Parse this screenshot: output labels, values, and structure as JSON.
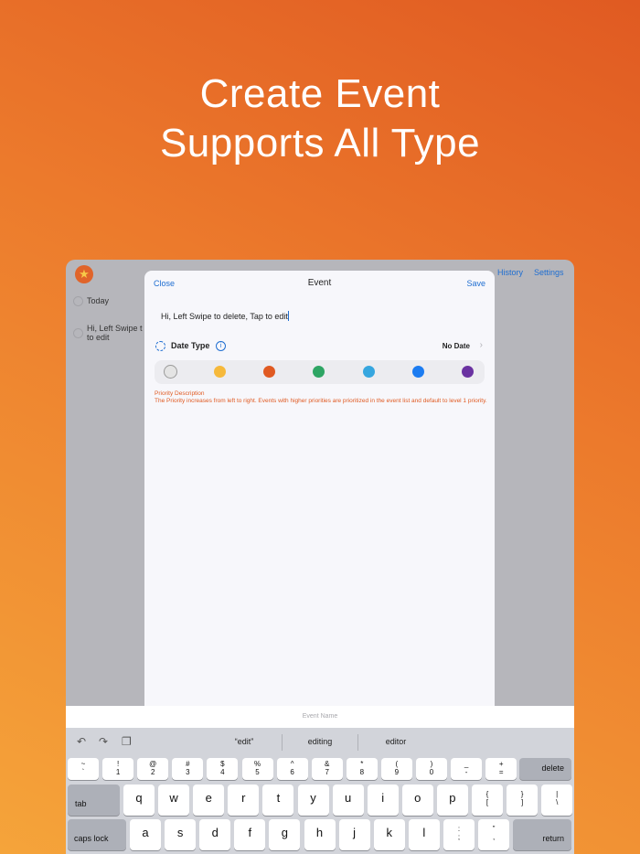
{
  "headline": {
    "line1": "Create Event",
    "line2": "Supports All Type"
  },
  "app": {
    "logo_icon": "star-icon",
    "nav_links": {
      "history": "History",
      "settings": "Settings"
    },
    "background_list": [
      "Today",
      "Hi,  Left Swipe t",
      "to edit"
    ]
  },
  "modal": {
    "close": "Close",
    "title": "Event",
    "save": "Save",
    "event_text": "Hi,  Left Swipe to delete,  Tap to edit",
    "date_type_label": "Date Type",
    "date_value": "No Date",
    "priority_colors": [
      "#e4e4e4",
      "#f6b93b",
      "#e05a22",
      "#2ea564",
      "#36a6df",
      "#1c7cf1",
      "#6a32a1"
    ],
    "selected_priority": 0,
    "priority_title": "Priority Description",
    "priority_description": " The Priority increases from left to right. Events with higher priorities are prioritized in the event list and default to level 1 priority."
  },
  "input_placeholder": "Event Name",
  "keyboard": {
    "suggestions": [
      "“edit”",
      "editing",
      "editor"
    ],
    "number_row": [
      [
        "~",
        "`"
      ],
      [
        "!",
        "1"
      ],
      [
        "@",
        "2"
      ],
      [
        "#",
        "3"
      ],
      [
        "$",
        "4"
      ],
      [
        "%",
        "5"
      ],
      [
        "^",
        "6"
      ],
      [
        "&",
        "7"
      ],
      [
        "*",
        "8"
      ],
      [
        "(",
        "9"
      ],
      [
        ")",
        "0"
      ],
      [
        "_",
        "-"
      ],
      [
        "+",
        "="
      ]
    ],
    "delete": "delete",
    "tab": "tab",
    "row2": [
      "q",
      "w",
      "e",
      "r",
      "t",
      "y",
      "u",
      "i",
      "o",
      "p"
    ],
    "row2_extra": [
      [
        "{",
        "["
      ],
      [
        "}",
        "]"
      ],
      [
        "|",
        "\\"
      ]
    ],
    "caps_lock": "caps lock",
    "row3": [
      "a",
      "s",
      "d",
      "f",
      "g",
      "h",
      "j",
      "k",
      "l"
    ],
    "row3_extra": [
      [
        ":",
        ";"
      ],
      [
        "”",
        ","
      ]
    ],
    "return": "return"
  }
}
